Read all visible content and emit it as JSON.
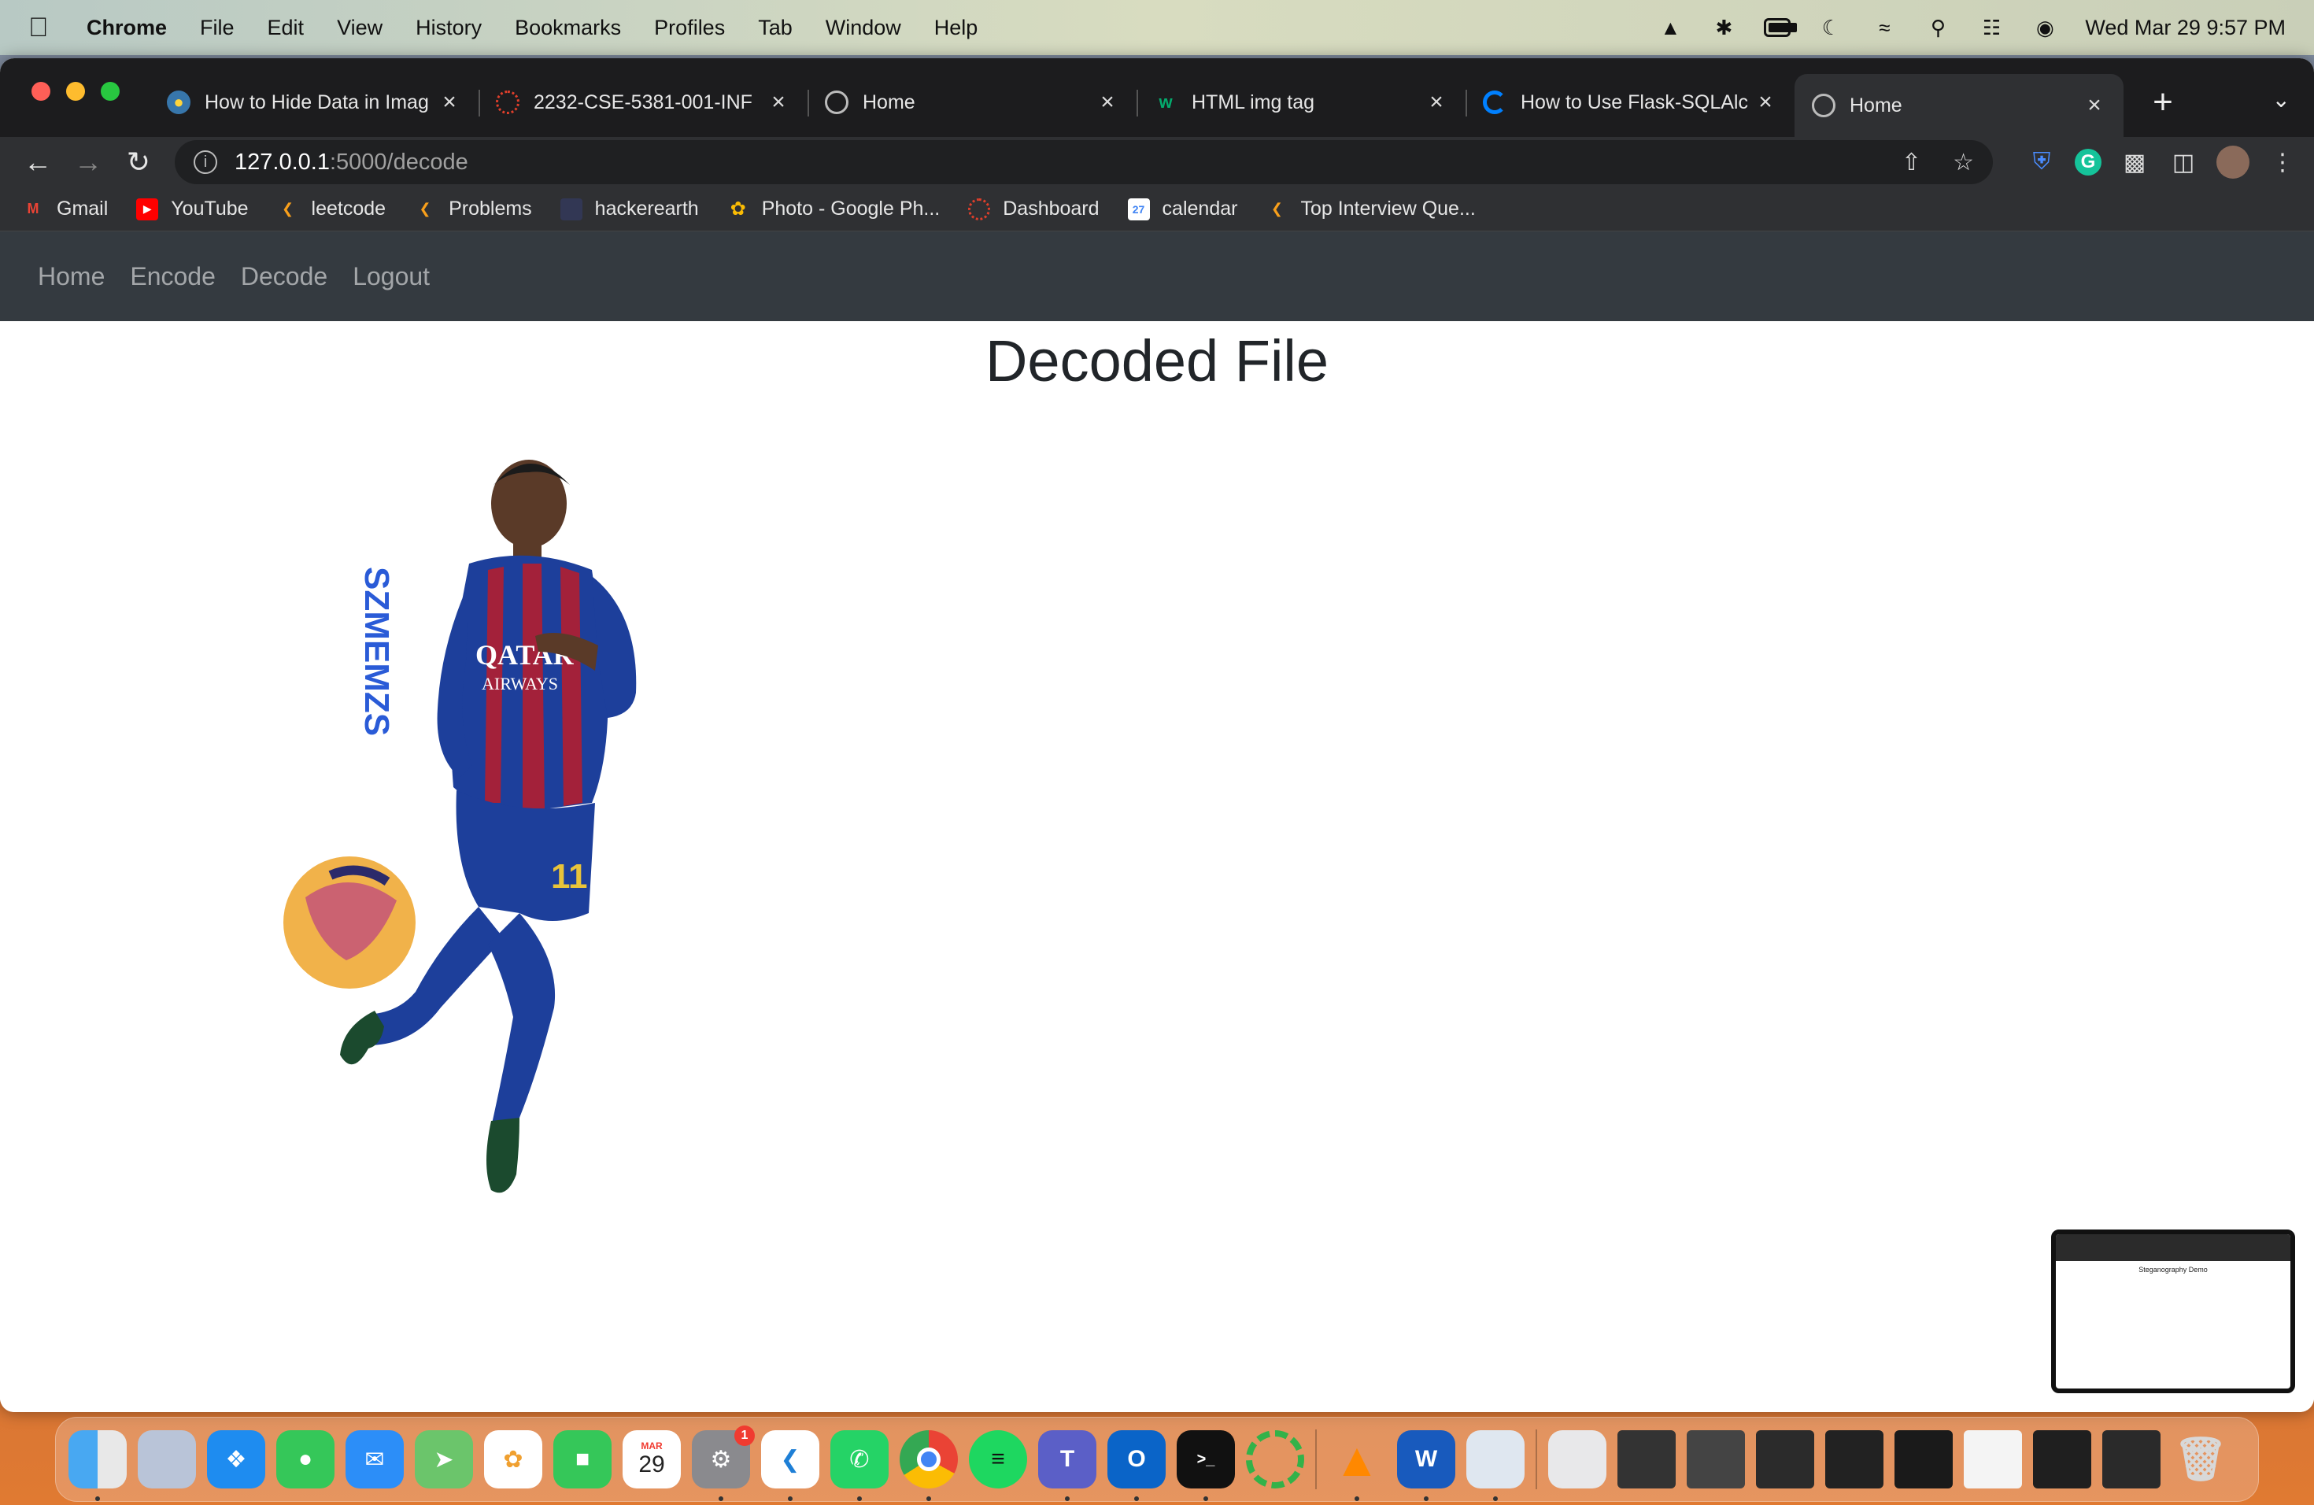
{
  "menubar": {
    "app_name": "Chrome",
    "items": [
      "File",
      "Edit",
      "View",
      "History",
      "Bookmarks",
      "Profiles",
      "Tab",
      "Window",
      "Help"
    ],
    "clock": "Wed Mar 29  9:57 PM"
  },
  "tabs": [
    {
      "title": "How to Hide Data in Imag",
      "icon": "python-icon",
      "active": false
    },
    {
      "title": "2232-CSE-5381-001-INF",
      "icon": "canvas-icon",
      "active": false
    },
    {
      "title": "Home",
      "icon": "globe-icon",
      "active": false
    },
    {
      "title": "HTML img tag",
      "icon": "w3schools-icon",
      "active": false
    },
    {
      "title": "How to Use Flask-SQLAlc",
      "icon": "digitalocean-icon",
      "active": false
    },
    {
      "title": "Home",
      "icon": "globe-icon",
      "active": true
    }
  ],
  "address": {
    "host": "127.0.0.1",
    "path": ":5000/decode"
  },
  "bookmarks": [
    {
      "label": "Gmail",
      "icon": "gmail-icon",
      "color": "#ea4335"
    },
    {
      "label": "YouTube",
      "icon": "youtube-icon",
      "color": "#ff0000"
    },
    {
      "label": "leetcode",
      "icon": "leetcode-icon",
      "color": "#f89f1b"
    },
    {
      "label": "Problems",
      "icon": "leetcode-icon",
      "color": "#f89f1b"
    },
    {
      "label": "hackerearth",
      "icon": "hackerearth-icon",
      "color": "#323754"
    },
    {
      "label": "Photo - Google Ph...",
      "icon": "google-photos-icon",
      "color": "#fbbc04"
    },
    {
      "label": "Dashboard",
      "icon": "canvas-icon",
      "color": "#e13f2b"
    },
    {
      "label": "calendar",
      "icon": "calendar-icon",
      "color": "#4285f4"
    },
    {
      "label": "Top Interview Que...",
      "icon": "leetcode-icon",
      "color": "#f89f1b"
    }
  ],
  "site_nav": [
    "Home",
    "Encode",
    "Decode",
    "Logout"
  ],
  "page": {
    "heading": "Decoded File",
    "image_alt": "decoded image - soccer player kicking ball",
    "watermark": "SZMEMZS"
  },
  "thumbnail": {
    "title": "Steganography Demo"
  },
  "dock": {
    "calendar_month": "MAR",
    "calendar_day": "29",
    "settings_badge": "1"
  },
  "colors": {
    "site_nav_bg": "#343a40",
    "tab_strip_bg": "#1c1c1e",
    "toolbar_bg": "#2f3033",
    "jersey_blue": "#1d3f9b",
    "jersey_red": "#a3213a"
  }
}
